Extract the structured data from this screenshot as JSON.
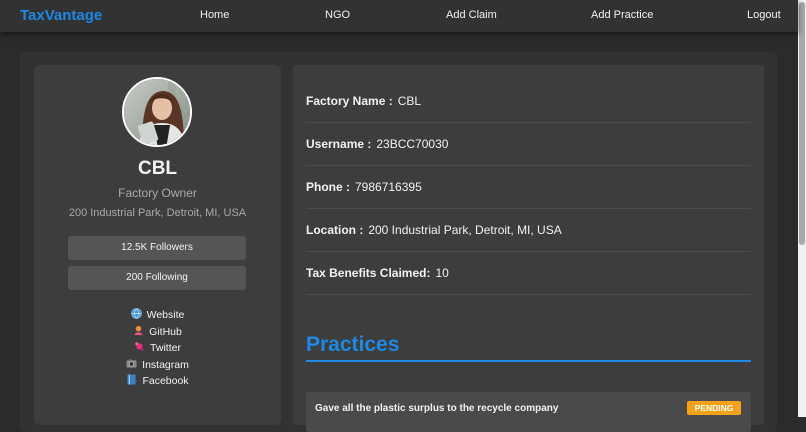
{
  "navbar": {
    "brand": "TaxVantage",
    "links": [
      "Home",
      "NGO",
      "Add Claim",
      "Add Practice",
      "Logout"
    ],
    "brand_color": "#1e88e5"
  },
  "profile": {
    "name": "CBL",
    "role": "Factory Owner",
    "address": "200 Industrial Park, Detroit, MI, USA",
    "followers": "12.5K Followers",
    "following": "200 Following",
    "social": [
      {
        "label": "Website",
        "icon": "globe-icon"
      },
      {
        "label": "GitHub",
        "icon": "github-icon"
      },
      {
        "label": "Twitter",
        "icon": "twitter-icon"
      },
      {
        "label": "Instagram",
        "icon": "instagram-icon"
      },
      {
        "label": "Facebook",
        "icon": "facebook-icon"
      }
    ]
  },
  "details": [
    {
      "label": "Factory Name :",
      "value": "CBL"
    },
    {
      "label": "Username :",
      "value": "23BCC70030"
    },
    {
      "label": "Phone :",
      "value": "7986716395"
    },
    {
      "label": "Location :",
      "value": "200 Industrial Park, Detroit, MI, USA"
    },
    {
      "label": "Tax Benefits Claimed:",
      "value": "10"
    }
  ],
  "practices": {
    "title": "Practices",
    "items": [
      {
        "text": "Gave all the plastic surplus to the recycle company",
        "status": "PENDING",
        "status_color": "#f5a11a"
      }
    ]
  }
}
